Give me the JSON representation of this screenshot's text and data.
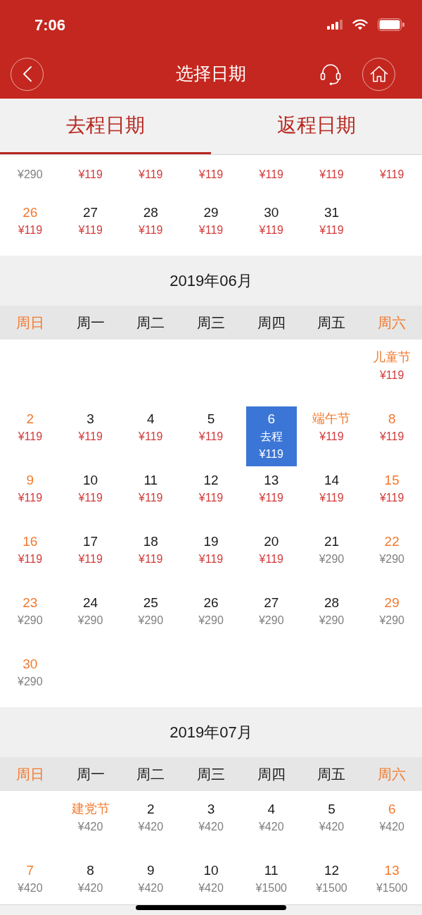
{
  "status_bar": {
    "time": "7:06"
  },
  "nav_bar": {
    "title": "选择日期"
  },
  "tabs": [
    {
      "label": "去程日期",
      "selected": true
    },
    {
      "label": "返程日期",
      "selected": false
    }
  ],
  "months": [
    {
      "rows": [
        [
          {
            "price": "¥290",
            "low_fare": false,
            "selected": false
          },
          {
            "price": "¥119",
            "low_fare": true,
            "selected": false
          },
          {
            "price": "¥119",
            "low_fare": true,
            "selected": false
          },
          {
            "price": "¥119",
            "low_fare": true,
            "selected": false
          },
          {
            "price": "¥119",
            "low_fare": true,
            "selected": false
          },
          {
            "price": "¥119",
            "low_fare": true,
            "selected": false
          },
          {
            "price": "¥119",
            "low_fare": true,
            "selected": false
          }
        ],
        [
          {
            "label": "26",
            "kind": "weekend",
            "price": "¥119",
            "low_fare": true,
            "selected": false
          },
          {
            "label": "27",
            "kind": "weekday",
            "price": "¥119",
            "low_fare": true,
            "selected": false
          },
          {
            "label": "28",
            "kind": "weekday",
            "price": "¥119",
            "low_fare": true,
            "selected": false
          },
          {
            "label": "29",
            "kind": "weekday",
            "price": "¥119",
            "low_fare": true,
            "selected": false
          },
          {
            "label": "30",
            "kind": "weekday",
            "price": "¥119",
            "low_fare": true,
            "selected": false
          },
          {
            "label": "31",
            "kind": "weekday",
            "price": "¥119",
            "low_fare": true,
            "selected": false
          },
          null
        ]
      ]
    },
    {
      "title": "2019年06月",
      "weekdays": [
        {
          "label": "周日",
          "weekend": true
        },
        {
          "label": "周一",
          "weekend": false
        },
        {
          "label": "周二",
          "weekend": false
        },
        {
          "label": "周三",
          "weekend": false
        },
        {
          "label": "周四",
          "weekend": false
        },
        {
          "label": "周五",
          "weekend": false
        },
        {
          "label": "周六",
          "weekend": true
        }
      ],
      "rows": [
        [
          null,
          null,
          null,
          null,
          null,
          null,
          {
            "label": "儿童节",
            "kind": "holiday",
            "price": "¥119",
            "low_fare": true,
            "selected": false
          }
        ],
        [
          {
            "label": "2",
            "kind": "weekend",
            "price": "¥119",
            "low_fare": true,
            "selected": false
          },
          {
            "label": "3",
            "kind": "weekday",
            "price": "¥119",
            "low_fare": true,
            "selected": false
          },
          {
            "label": "4",
            "kind": "weekday",
            "price": "¥119",
            "low_fare": true,
            "selected": false
          },
          {
            "label": "5",
            "kind": "weekday",
            "price": "¥119",
            "low_fare": true,
            "selected": false
          },
          {
            "label": "6",
            "kind": "weekday",
            "note": "去程",
            "price": "¥119",
            "low_fare": true,
            "selected": true
          },
          {
            "label": "端午节",
            "kind": "holiday",
            "price": "¥119",
            "low_fare": true,
            "selected": false
          },
          {
            "label": "8",
            "kind": "weekend",
            "price": "¥119",
            "low_fare": true,
            "selected": false
          }
        ],
        [
          {
            "label": "9",
            "kind": "weekend",
            "price": "¥119",
            "low_fare": true,
            "selected": false
          },
          {
            "label": "10",
            "kind": "weekday",
            "price": "¥119",
            "low_fare": true,
            "selected": false
          },
          {
            "label": "11",
            "kind": "weekday",
            "price": "¥119",
            "low_fare": true,
            "selected": false
          },
          {
            "label": "12",
            "kind": "weekday",
            "price": "¥119",
            "low_fare": true,
            "selected": false
          },
          {
            "label": "13",
            "kind": "weekday",
            "price": "¥119",
            "low_fare": true,
            "selected": false
          },
          {
            "label": "14",
            "kind": "weekday",
            "price": "¥119",
            "low_fare": true,
            "selected": false
          },
          {
            "label": "15",
            "kind": "weekend",
            "price": "¥119",
            "low_fare": true,
            "selected": false
          }
        ],
        [
          {
            "label": "16",
            "kind": "weekend",
            "price": "¥119",
            "low_fare": true,
            "selected": false
          },
          {
            "label": "17",
            "kind": "weekday",
            "price": "¥119",
            "low_fare": true,
            "selected": false
          },
          {
            "label": "18",
            "kind": "weekday",
            "price": "¥119",
            "low_fare": true,
            "selected": false
          },
          {
            "label": "19",
            "kind": "weekday",
            "price": "¥119",
            "low_fare": true,
            "selected": false
          },
          {
            "label": "20",
            "kind": "weekday",
            "price": "¥119",
            "low_fare": true,
            "selected": false
          },
          {
            "label": "21",
            "kind": "weekday",
            "price": "¥290",
            "low_fare": false,
            "selected": false
          },
          {
            "label": "22",
            "kind": "weekend",
            "price": "¥290",
            "low_fare": false,
            "selected": false
          }
        ],
        [
          {
            "label": "23",
            "kind": "weekend",
            "price": "¥290",
            "low_fare": false,
            "selected": false
          },
          {
            "label": "24",
            "kind": "weekday",
            "price": "¥290",
            "low_fare": false,
            "selected": false
          },
          {
            "label": "25",
            "kind": "weekday",
            "price": "¥290",
            "low_fare": false,
            "selected": false
          },
          {
            "label": "26",
            "kind": "weekday",
            "price": "¥290",
            "low_fare": false,
            "selected": false
          },
          {
            "label": "27",
            "kind": "weekday",
            "price": "¥290",
            "low_fare": false,
            "selected": false
          },
          {
            "label": "28",
            "kind": "weekday",
            "price": "¥290",
            "low_fare": false,
            "selected": false
          },
          {
            "label": "29",
            "kind": "weekend",
            "price": "¥290",
            "low_fare": false,
            "selected": false
          }
        ],
        [
          {
            "label": "30",
            "kind": "weekend",
            "price": "¥290",
            "low_fare": false,
            "selected": false
          },
          null,
          null,
          null,
          null,
          null,
          null
        ]
      ]
    },
    {
      "title": "2019年07月",
      "weekdays": [
        {
          "label": "周日",
          "weekend": true
        },
        {
          "label": "周一",
          "weekend": false
        },
        {
          "label": "周二",
          "weekend": false
        },
        {
          "label": "周三",
          "weekend": false
        },
        {
          "label": "周四",
          "weekend": false
        },
        {
          "label": "周五",
          "weekend": false
        },
        {
          "label": "周六",
          "weekend": true
        }
      ],
      "rows": [
        [
          null,
          {
            "label": "建党节",
            "kind": "holiday",
            "price": "¥420",
            "low_fare": false,
            "selected": false
          },
          {
            "label": "2",
            "kind": "weekday",
            "price": "¥420",
            "low_fare": false,
            "selected": false
          },
          {
            "label": "3",
            "kind": "weekday",
            "price": "¥420",
            "low_fare": false,
            "selected": false
          },
          {
            "label": "4",
            "kind": "weekday",
            "price": "¥420",
            "low_fare": false,
            "selected": false
          },
          {
            "label": "5",
            "kind": "weekday",
            "price": "¥420",
            "low_fare": false,
            "selected": false
          },
          {
            "label": "6",
            "kind": "weekend",
            "price": "¥420",
            "low_fare": false,
            "selected": false
          }
        ],
        [
          {
            "label": "7",
            "kind": "weekend",
            "price": "¥420",
            "low_fare": false,
            "selected": false
          },
          {
            "label": "8",
            "kind": "weekday",
            "price": "¥420",
            "low_fare": false,
            "selected": false
          },
          {
            "label": "9",
            "kind": "weekday",
            "price": "¥420",
            "low_fare": false,
            "selected": false
          },
          {
            "label": "10",
            "kind": "weekday",
            "price": "¥420",
            "low_fare": false,
            "selected": false
          },
          {
            "label": "11",
            "kind": "weekday",
            "price": "¥1500",
            "low_fare": false,
            "selected": false
          },
          {
            "label": "12",
            "kind": "weekday",
            "price": "¥1500",
            "low_fare": false,
            "selected": false
          },
          {
            "label": "13",
            "kind": "weekend",
            "price": "¥1500",
            "low_fare": false,
            "selected": false
          }
        ]
      ]
    }
  ]
}
